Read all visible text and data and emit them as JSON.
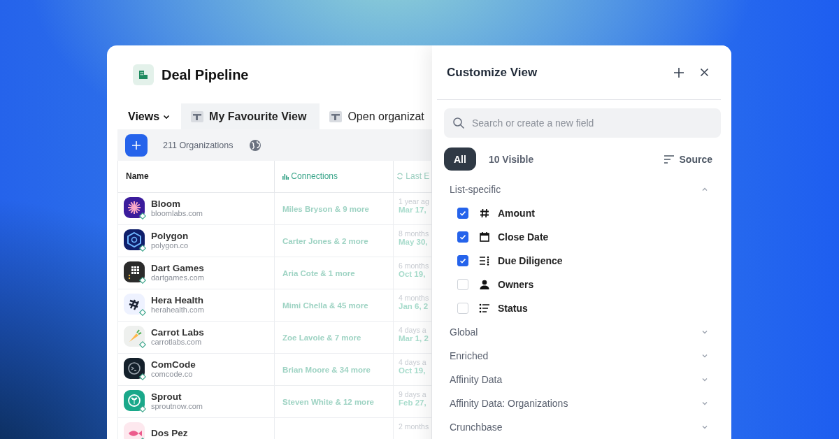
{
  "app": {
    "title": "Deal Pipeline"
  },
  "views_menu": {
    "label": "Views"
  },
  "tabs": [
    {
      "label": "My Favourite View",
      "selected": true
    },
    {
      "label": "Open organizat",
      "selected": false
    }
  ],
  "toolbar": {
    "count": "211 Organizations"
  },
  "table": {
    "columns": [
      {
        "label": "Name",
        "kind": "plain"
      },
      {
        "label": "Connections",
        "kind": "bars"
      },
      {
        "label": "Last E",
        "kind": "sync"
      }
    ],
    "rows": [
      {
        "name": "Bloom",
        "domain": "bloomlabs.com",
        "kind": "burst",
        "color": "#3b1c9c",
        "connections": "Miles Bryson & 9 more",
        "column_3": [
          "1 year ag",
          "Mar 17,"
        ]
      },
      {
        "name": "Polygon",
        "domain": "polygon.co",
        "kind": "hexagon",
        "color": "#0f1f6b",
        "connections": "Carter Jones & 2 more",
        "column_3": [
          "8 months",
          "May 30,"
        ]
      },
      {
        "name": "Dart Games",
        "domain": "dartgames.com",
        "kind": "grid",
        "color": "#2b2b2b",
        "connections": "Aria Cote & 1 more",
        "column_3": [
          "6 months",
          "Oct 19,"
        ]
      },
      {
        "name": "Hera Health",
        "domain": "herahealth.com",
        "kind": "stripes",
        "color": "#eef2ff",
        "connections": "Mimi Chella & 45 more",
        "column_3": [
          "4 months",
          "Jan 6, 2"
        ]
      },
      {
        "name": "Carrot Labs",
        "domain": "carrotlabs.com",
        "kind": "carrot",
        "color": "#eef0ee",
        "connections": "Zoe Lavoie & 7 more",
        "column_3": [
          "4 days a",
          "Mar 1, 2"
        ]
      },
      {
        "name": "ComCode",
        "domain": "comcode.co",
        "kind": "chat",
        "color": "#14202b",
        "connections": "Brian Moore & 34 more",
        "column_3": [
          "4 days a",
          "Oct 19,"
        ]
      },
      {
        "name": "Sprout",
        "domain": "sproutnow.com",
        "kind": "sprout",
        "color": "#1aa88a",
        "connections": "Steven White & 12 more",
        "column_3": [
          "9 days a",
          "Feb 27,"
        ]
      },
      {
        "name": "Dos Pez",
        "kind": "fish",
        "color": "#fde8ee",
        "column_3": [
          "2 months"
        ]
      }
    ]
  },
  "panel": {
    "title": "Customize View",
    "search": {
      "placeholder": "Search or create a new field"
    },
    "filters": [
      {
        "label": "All",
        "selected": true
      },
      {
        "label": "10 Visible",
        "selected": false
      }
    ],
    "sort": {
      "label": "Source"
    },
    "sections": [
      {
        "label": "List-specific",
        "expanded": true,
        "fields": [
          {
            "label": "Amount",
            "kind": "number",
            "checked": true
          },
          {
            "label": "Close Date",
            "kind": "date",
            "checked": true
          },
          {
            "label": "Due Diligence",
            "kind": "list",
            "checked": true
          },
          {
            "label": "Owners",
            "kind": "person",
            "checked": false
          },
          {
            "label": "Status",
            "kind": "status",
            "checked": false
          }
        ]
      },
      {
        "label": "Global",
        "expanded": false
      },
      {
        "label": "Enriched",
        "expanded": false
      },
      {
        "label": "Affinity Data",
        "expanded": false
      },
      {
        "label": "Affinity Data: Organizations",
        "expanded": false
      },
      {
        "label": "Crunchbase",
        "expanded": false
      }
    ]
  }
}
